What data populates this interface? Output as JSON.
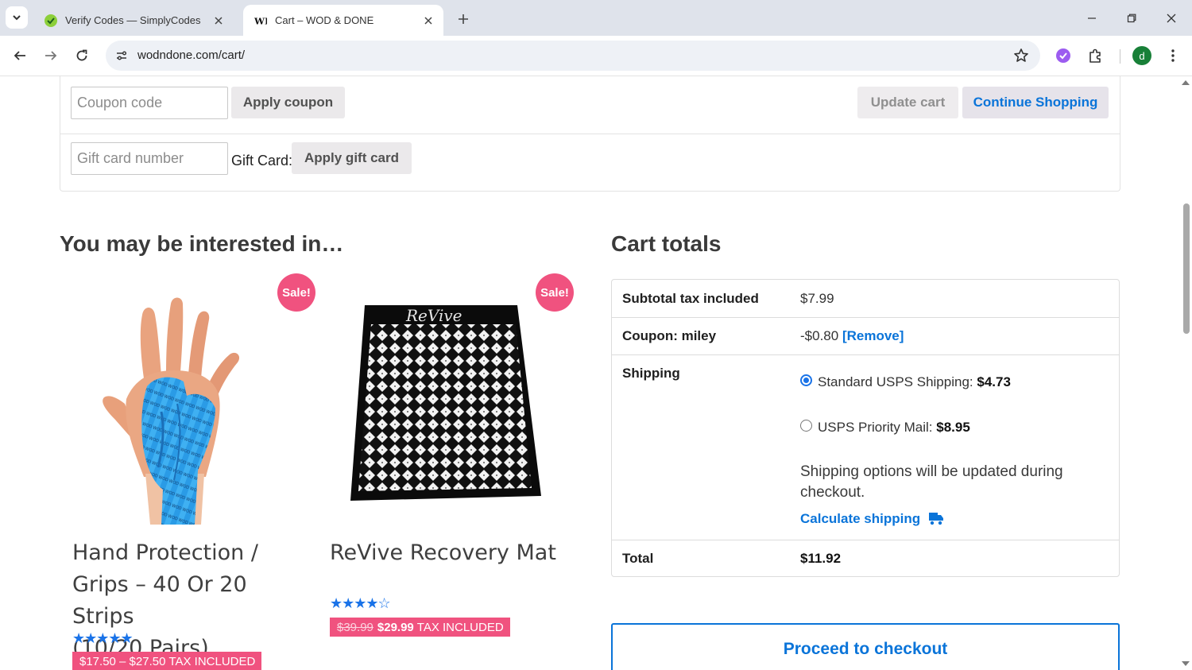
{
  "browser": {
    "tabs": [
      {
        "title": "Verify Codes — SimplyCodes",
        "active": false
      },
      {
        "title": "Cart – WOD & DONE",
        "active": true
      }
    ],
    "url": "wodndone.com/cart/",
    "profile_initial": "d",
    "icons": {
      "tab_search": "chevron-down-icon",
      "back": "arrow-left-icon",
      "forward": "arrow-right-icon",
      "reload": "reload-icon",
      "site_info": "tune-icon",
      "bookmark": "star-icon",
      "extension_1": "simplycodes-extension-icon",
      "extensions": "puzzle-icon",
      "menu": "kebab-menu-icon",
      "minimize": "minimize-icon",
      "restore": "restore-icon",
      "close": "close-icon"
    }
  },
  "cart_actions": {
    "coupon_placeholder": "Coupon code",
    "apply_coupon": "Apply coupon",
    "update_cart": "Update cart",
    "continue_shopping": "Continue Shopping",
    "giftcard_placeholder": "Gift card number",
    "giftcard_label": "Gift Card:",
    "apply_giftcard": "Apply gift card"
  },
  "cross_sells": {
    "title": "You may be interested in…",
    "products": [
      {
        "name_lines": [
          "Hand Protection /",
          "Grips – 40 Or 20 Strips",
          "(10/20 Pairs)"
        ],
        "badge": "Sale!",
        "rating": 5,
        "stars": "★★★★★",
        "price_range": "$17.50 – $27.50",
        "tax_note": "TAX INCLUDED"
      },
      {
        "name_lines": [
          "ReVive Recovery Mat"
        ],
        "badge": "Sale!",
        "rating": 4,
        "stars": "★★★★☆",
        "old_price": "$39.99",
        "new_price": "$29.99",
        "tax_note": "TAX INCLUDED",
        "image_brand_text": "ReVive"
      }
    ]
  },
  "cart_totals": {
    "title": "Cart totals",
    "subtotal_label": "Subtotal tax included",
    "subtotal_value": "$7.99",
    "coupon_label": "Coupon: miley",
    "coupon_value": "-$0.80",
    "coupon_remove": "[Remove]",
    "shipping_label": "Shipping",
    "shipping_options": [
      {
        "label": "Standard USPS Shipping:",
        "price": "$4.73",
        "selected": true
      },
      {
        "label": "USPS Priority Mail:",
        "price": "$8.95",
        "selected": false
      }
    ],
    "shipping_note": "Shipping options will be updated during checkout.",
    "calculate_shipping": "Calculate shipping",
    "total_label": "Total",
    "total_value": "$11.92",
    "checkout": "Proceed to checkout",
    "colors": {
      "accent": "#0a74d9",
      "sale": "#f0527f"
    }
  }
}
